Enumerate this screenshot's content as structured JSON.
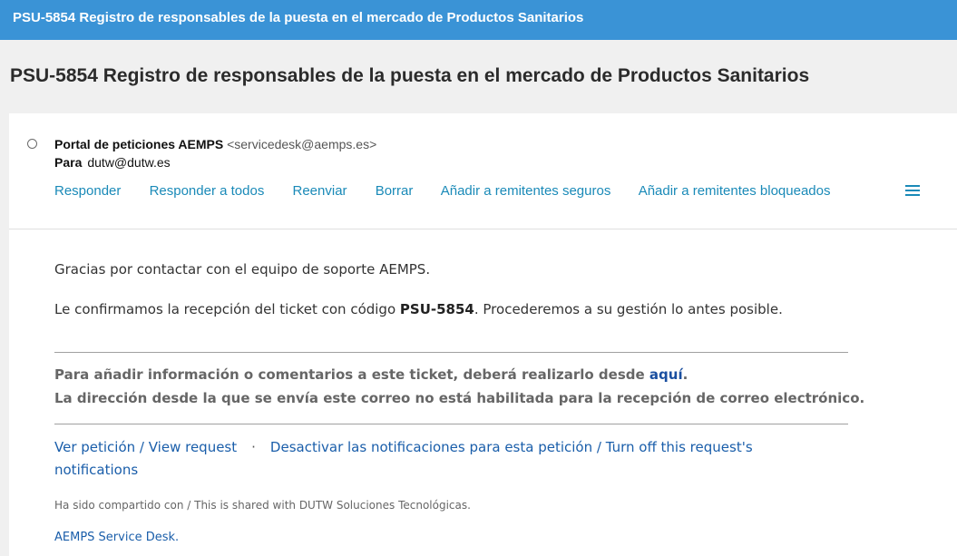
{
  "window": {
    "title": "PSU-5854 Registro de responsables de la puesta en el mercado de Productos Sanitarios"
  },
  "message": {
    "subject": "PSU-5854 Registro de responsables de la puesta en el mercado de Productos Sanitarios",
    "from_name": "Portal de peticiones AEMPS",
    "from_email": "<servicedesk@aemps.es>",
    "to_label": "Para",
    "to_value": "dutw@dutw.es"
  },
  "actions": {
    "reply": "Responder",
    "reply_all": "Responder a todos",
    "forward": "Reenviar",
    "delete": "Borrar",
    "add_safe": "Añadir a remitentes seguros",
    "add_blocked": "Añadir a remitentes bloqueados",
    "menu_icon": "hamburger-menu-icon"
  },
  "body": {
    "greeting": "Gracias por contactar con el equipo de soporte AEMPS.",
    "confirm_prefix": "Le confirmamos la recepción del ticket con código ",
    "ticket_code": "PSU-5854",
    "confirm_suffix": ". Procederemos a su gestión lo antes posible.",
    "notice_line1_prefix": "Para añadir información o comentarios a este ticket, deberá realizarlo desde ",
    "notice_link": "aquí",
    "notice_line1_suffix": ".",
    "notice_line2": "La dirección desde la que se envía este correo no está habilitada para la recepción de correo electrónico.",
    "view_request": "Ver petición / View request",
    "separator": "·",
    "turn_off": "Desactivar las notificaciones para esta petición / Turn off this request's notifications",
    "shared_with": "Ha sido compartido con / This is shared with DUTW Soluciones Tecnológicas.",
    "service_desk": "AEMPS Service Desk."
  },
  "colors": {
    "titlebar": "#3a93d6",
    "action_link": "#1a8ab8",
    "body_link": "#1a5eaa"
  }
}
